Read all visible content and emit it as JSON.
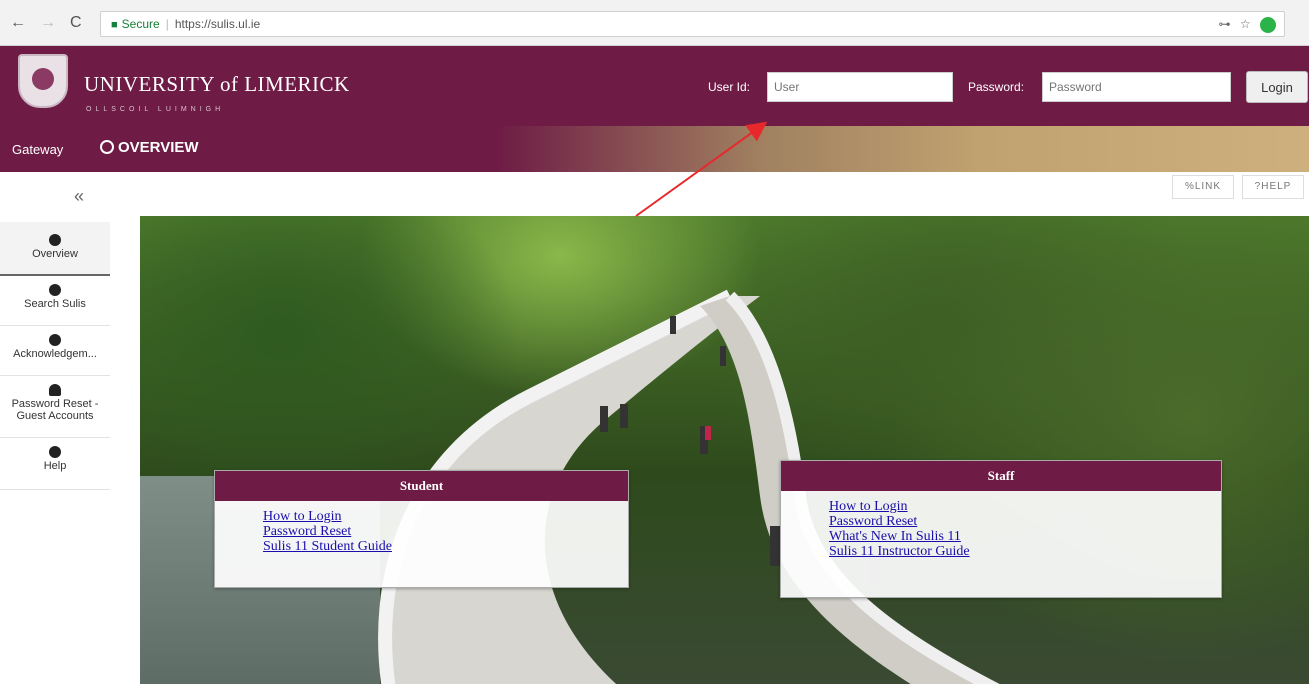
{
  "browser": {
    "secure_label": "Secure",
    "url": "https://sulis.ul.ie",
    "back_icon": "←",
    "forward_icon": "→",
    "reload_icon": "C",
    "key_icon": "⊶",
    "star_icon": "☆"
  },
  "header": {
    "university_name": "UNIVERSITY of LIMERICK",
    "university_sub": "OLLSCOIL LUIMNIGH",
    "user_id_label": "User Id:",
    "user_placeholder": "User",
    "password_label": "Password:",
    "password_placeholder": "Password",
    "login_label": "Login"
  },
  "nav": {
    "gateway": "Gateway",
    "overview": "OVERVIEW"
  },
  "toolbar": {
    "link_label": "%LINK",
    "help_label": "?HELP",
    "collapse_icon": "«"
  },
  "sidebar": {
    "items": [
      {
        "label": "Overview",
        "icon": "globe-icon"
      },
      {
        "label": "Search Sulis",
        "icon": "globe-icon"
      },
      {
        "label": "Acknowledgem...",
        "icon": "globe-icon"
      },
      {
        "label": "Password Reset - Guest Accounts",
        "icon": "user-icon"
      },
      {
        "label": "Help",
        "icon": "question-icon"
      }
    ]
  },
  "student": {
    "title": "Student",
    "links": [
      "How to Login",
      "Password Reset",
      "Sulis 11 Student Guide"
    ]
  },
  "staff": {
    "title": "Staff",
    "links": [
      "How to Login",
      "Password Reset",
      "What's New In Sulis 11",
      "Sulis 11 Instructor Guide"
    ]
  },
  "colors": {
    "brand": "#6e1c45",
    "gold": "#cdb07d",
    "link": "#1a0dab",
    "annotation_arrow": "#e8282b"
  }
}
